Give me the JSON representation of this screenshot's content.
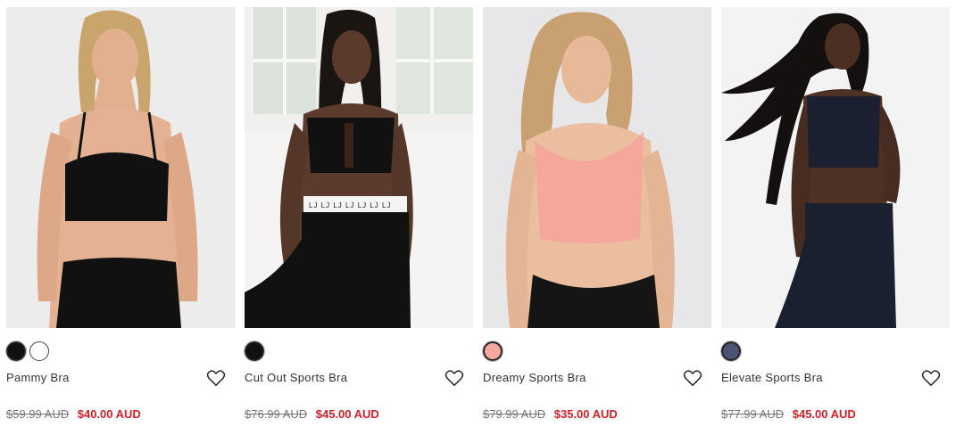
{
  "products": [
    {
      "name": "Pammy Bra",
      "was_price": "$59.99 AUD",
      "sale_price": "$40.00 AUD",
      "swatches": [
        "#111111",
        "#ffffff"
      ],
      "photo_bg": "#ececec",
      "garment_color": "#111111",
      "wishlist_icon": "heart-outline-icon"
    },
    {
      "name": "Cut Out Sports Bra",
      "was_price": "$76.99 AUD",
      "sale_price": "$45.00 AUD",
      "swatches": [
        "#111111"
      ],
      "photo_bg": "#f2f0ee",
      "garment_color": "#111111",
      "wishlist_icon": "heart-outline-icon"
    },
    {
      "name": "Dreamy Sports Bra",
      "was_price": "$79.99 AUD",
      "sale_price": "$35.00 AUD",
      "swatches": [
        "#f4a8a0"
      ],
      "photo_bg": "#e7e7e9",
      "garment_color": "#f5a79c",
      "wishlist_icon": "heart-outline-icon"
    },
    {
      "name": "Elevate Sports Bra",
      "was_price": "$77.99 AUD",
      "sale_price": "$45.00 AUD",
      "swatches": [
        "#4a5373"
      ],
      "photo_bg": "#f3f3f3",
      "garment_color": "#1b2030",
      "wishlist_icon": "heart-outline-icon"
    }
  ]
}
